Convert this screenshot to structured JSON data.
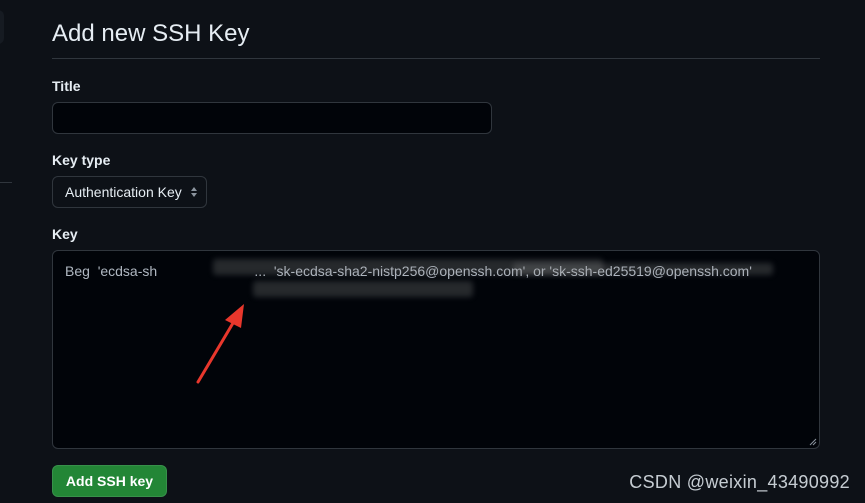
{
  "page": {
    "title": "Add new SSH Key"
  },
  "form": {
    "title_label": "Title",
    "title_value": "",
    "title_placeholder": "",
    "keytype_label": "Key type",
    "keytype_value": "Authentication Key",
    "key_label": "Key",
    "key_value": "Beg  'ecdsa-sh                         ...  'sk-ecdsa-sha2-nistp256@openssh.com', or 'sk-ssh-ed25519@openssh.com'",
    "submit_label": "Add SSH key"
  },
  "overlay": {
    "watermark": "CSDN @weixin_43490992",
    "arrow_color": "#e8372c"
  },
  "colors": {
    "background": "#0d1117",
    "input_bg": "#010409",
    "border": "#30363d",
    "primary_button": "#238636",
    "text": "#e6edf3"
  }
}
